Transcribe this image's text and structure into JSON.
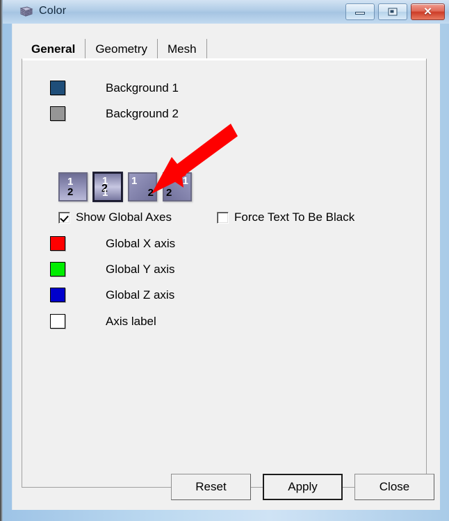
{
  "window": {
    "title": "Color",
    "icon": "mesh-grid-icon",
    "controls": {
      "minimize": "minimize-icon",
      "maximize": "maximize-icon",
      "close": "close-icon"
    }
  },
  "tabs": [
    {
      "label": "General",
      "active": true
    },
    {
      "label": "Geometry",
      "active": false
    },
    {
      "label": "Mesh",
      "active": false
    }
  ],
  "general": {
    "background_rows": [
      {
        "label": "Background 1",
        "color": "#1f4e79"
      },
      {
        "label": "Background 2",
        "color": "#969696"
      }
    ],
    "gradient_buttons": [
      {
        "name": "gradient-vertical-1-top",
        "top_label": "1",
        "bottom_label": "2",
        "selected": false
      },
      {
        "name": "gradient-center-2",
        "top_label": "1",
        "middle_label": "2",
        "bottom_label": "1",
        "selected": true
      },
      {
        "name": "gradient-diagonal-1-topleft",
        "top_label": "1",
        "bottom_label": "2",
        "selected": false
      },
      {
        "name": "gradient-diagonal-1-topright",
        "top_label": "1",
        "bottom_label": "2",
        "selected": false
      }
    ],
    "checkboxes": [
      {
        "label": "Show Global Axes",
        "checked": true
      },
      {
        "label": "Force Text To Be Black",
        "checked": false
      }
    ],
    "axis_rows": [
      {
        "label": "Global X axis",
        "color": "#ff0000"
      },
      {
        "label": "Global Y axis",
        "color": "#00ee00"
      },
      {
        "label": "Global Z axis",
        "color": "#0000cc"
      },
      {
        "label": "Axis label",
        "color": "#ffffff"
      }
    ]
  },
  "buttons": [
    {
      "label": "Reset",
      "default": false
    },
    {
      "label": "Apply",
      "default": true
    },
    {
      "label": "Close",
      "default": false
    }
  ],
  "annotation": {
    "type": "arrow",
    "color": "#fe0000",
    "points_to": "Show Global Axes"
  }
}
